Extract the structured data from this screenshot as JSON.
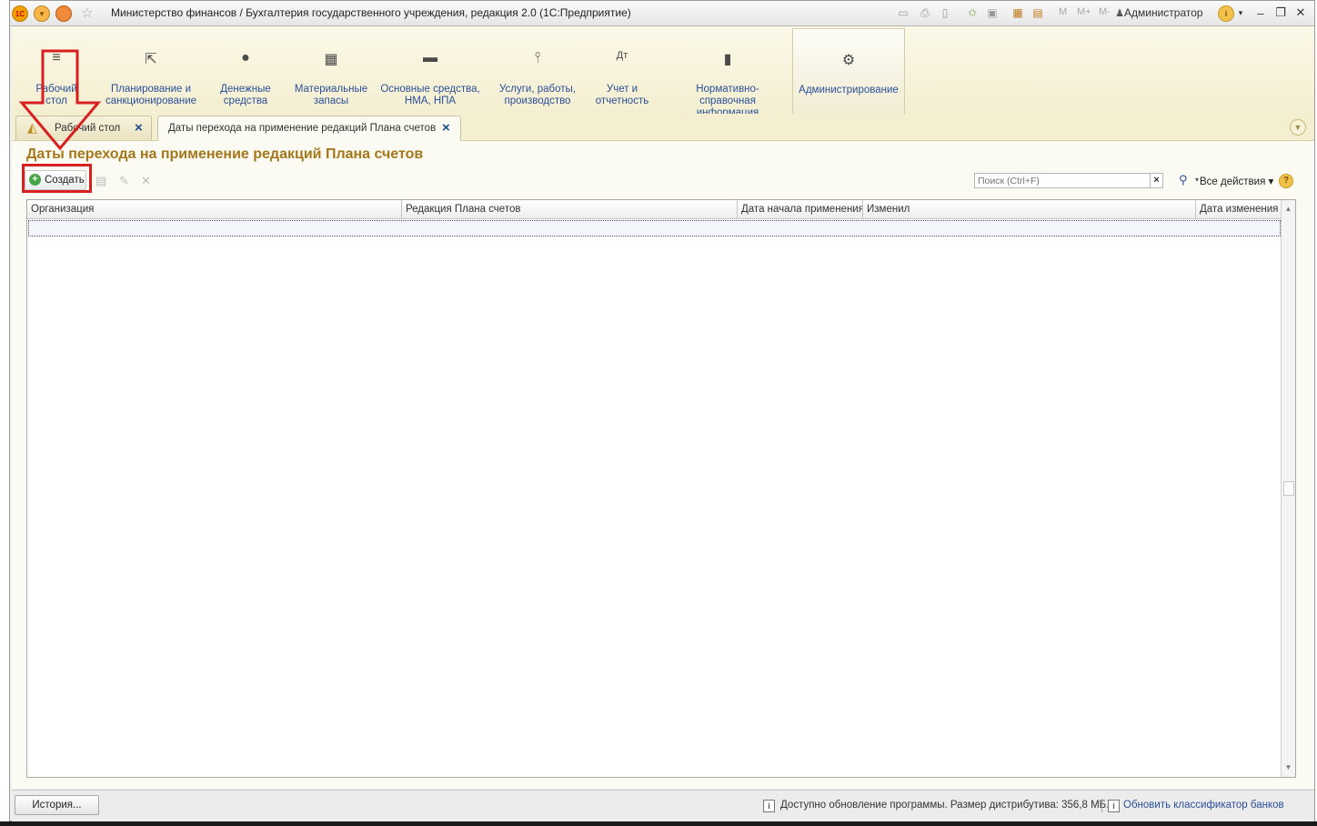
{
  "window": {
    "title": "Министерство финансов / Бухгалтерия государственного учреждения, редакция 2.0  (1С:Предприятие)",
    "logo_text": "1С",
    "user": "Администратор",
    "memory_buttons": [
      "M",
      "M+",
      "M-"
    ]
  },
  "sections": [
    {
      "label": "Рабочий стол",
      "icon": "menu-icon"
    },
    {
      "label": "Планирование и санкционирование",
      "icon": "chart-icon"
    },
    {
      "label": "Денежные средства",
      "icon": "ruble-icon"
    },
    {
      "label": "Материальные запасы",
      "icon": "boxes-icon"
    },
    {
      "label": "Основные средства, НМА, НПА",
      "icon": "truck-icon"
    },
    {
      "label": "Услуги, работы, производство",
      "icon": "tools-icon"
    },
    {
      "label": "Учет и отчетность",
      "icon": "debit-credit-icon"
    },
    {
      "label": "Нормативно-справочная информация",
      "icon": "book-icon"
    },
    {
      "label": "Администрирование",
      "icon": "gear-icon",
      "active": true
    }
  ],
  "open_tabs": [
    {
      "label": "Рабочий стол"
    },
    {
      "label": "Даты перехода на применение редакций Плана счетов",
      "current": true
    }
  ],
  "form": {
    "title": "Даты перехода на применение редакций Плана счетов",
    "create_label": "Создать",
    "search_placeholder": "Поиск (Ctrl+F)",
    "all_actions_label": "Все действия",
    "help_glyph": "?"
  },
  "table": {
    "columns": [
      "Организация",
      "Редакция Плана счетов",
      "Дата начала применения",
      "Изменил",
      "Дата изменения"
    ],
    "rows": []
  },
  "status": {
    "history_label": "История...",
    "update_message": "Доступно обновление программы. Размер дистрибутива: 356,8 МБ.",
    "update_link": "Обновить классификатор банков"
  },
  "colors": {
    "title_accent": "#a5771b",
    "link": "#2a4f99",
    "annotation_red": "#d92020",
    "panel_bg": "#f4efd1"
  }
}
